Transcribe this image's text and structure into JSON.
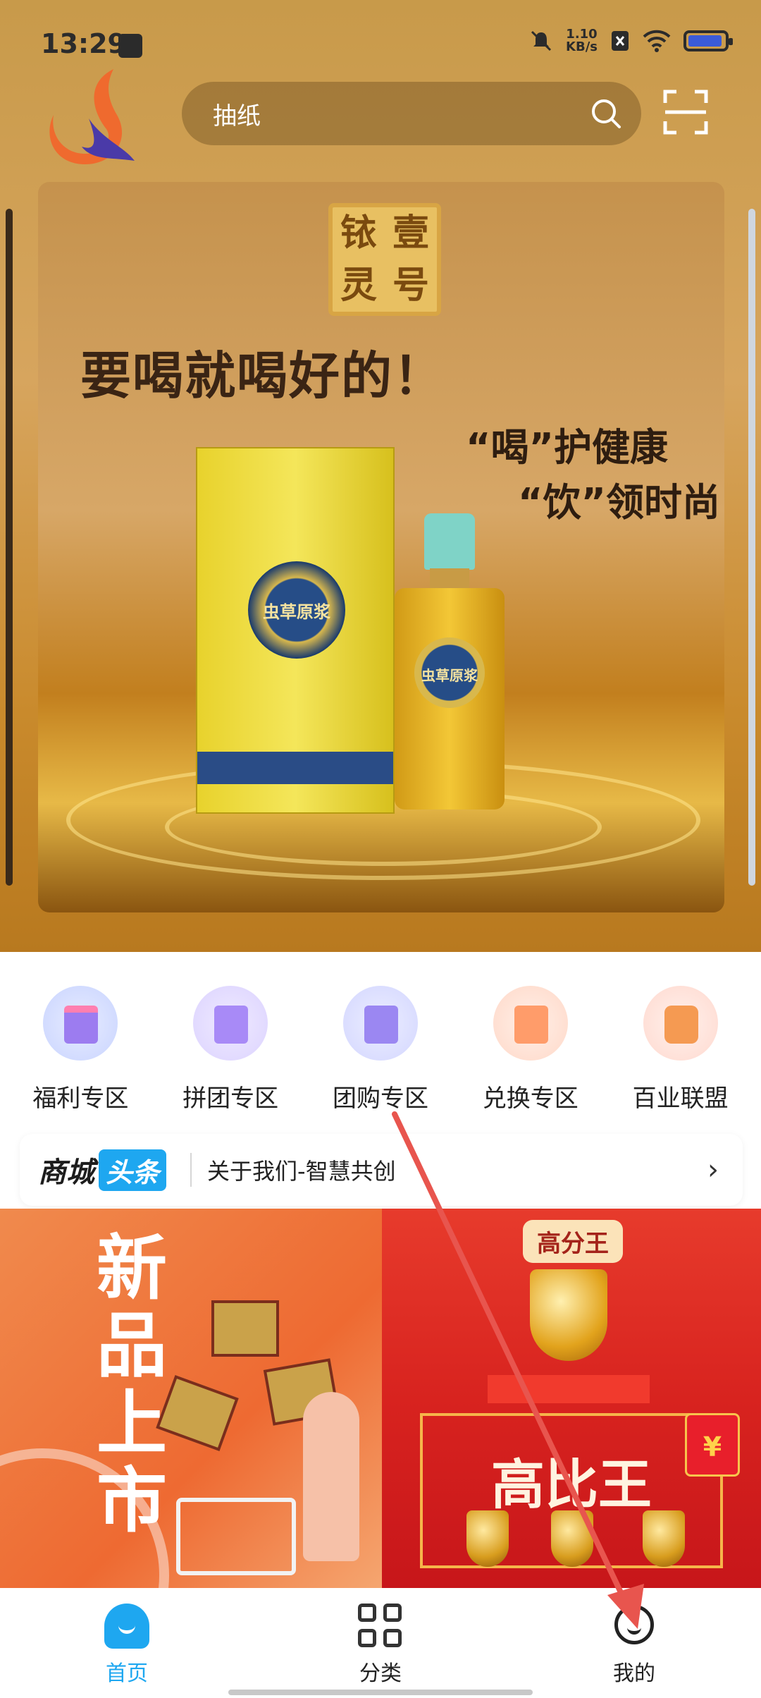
{
  "status_bar": {
    "time": "13:29",
    "network_speed_value": "1.10",
    "network_speed_unit": "KB/s"
  },
  "search": {
    "placeholder": "抽纸"
  },
  "banner": {
    "seal_chars": [
      "铱",
      "壹",
      "灵",
      "号"
    ],
    "slogan": "要喝就喝好的！",
    "sub_line_1": "“喝”护健康",
    "sub_line_2": "“饮”领时尚",
    "product_label": "虫草原浆"
  },
  "categories": [
    {
      "label": "福利专区",
      "icon": "gift-icon",
      "color": "#c9d4ff"
    },
    {
      "label": "拼团专区",
      "icon": "shopping-bag-icon",
      "color": "#dcd3ff"
    },
    {
      "label": "团购专区",
      "icon": "shopping-bag-icon",
      "color": "#d3d6ff"
    },
    {
      "label": "兑换专区",
      "icon": "exchange-icon",
      "color": "#ffd8c8"
    },
    {
      "label": "百业联盟",
      "icon": "alliance-icon",
      "color": "#ffd9cf"
    }
  ],
  "news": {
    "brand": "商城",
    "brand_tag": "头条",
    "headline": "关于我们-智慧共创",
    "arrow": "›"
  },
  "promo_left": {
    "title": "新品上市"
  },
  "promo_right": {
    "tag": "高分王",
    "title": "高比王",
    "envelope": "¥"
  },
  "bottom_nav": [
    {
      "label": "首页",
      "icon": "home-icon",
      "active": true
    },
    {
      "label": "分类",
      "icon": "category-grid-icon",
      "active": false
    },
    {
      "label": "我的",
      "icon": "profile-icon",
      "active": false
    }
  ],
  "colors": {
    "accent": "#1ea7f0",
    "annotation_arrow": "#e8554e"
  }
}
